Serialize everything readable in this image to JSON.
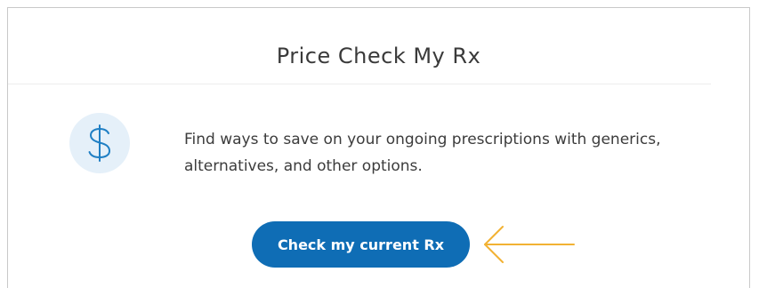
{
  "card": {
    "title": "Price Check My Rx",
    "description": "Find ways to save on your ongoing prescriptions with generics, alternatives, and other options.",
    "icon": "dollar-sign-icon",
    "button_label": "Check my current Rx"
  },
  "colors": {
    "accent": "#0f6db5",
    "icon_background": "#e5f0f9",
    "icon_glyph": "#1f7fc4",
    "annotation_arrow": "#f2b233",
    "border": "#c9c9c9",
    "text": "#3c3c3c"
  },
  "annotation": {
    "icon": "left-arrow-icon"
  }
}
